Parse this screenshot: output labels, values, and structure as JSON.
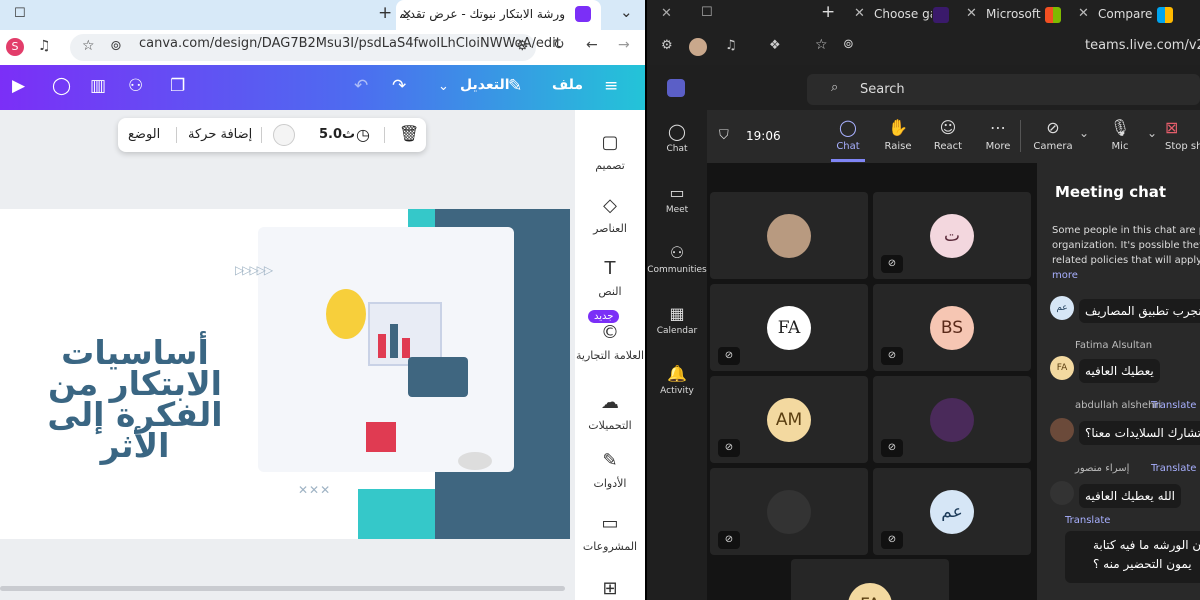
{
  "left_browser": {
    "tab_title": "ورشة الابتكار نيوتك - عرض تقديمي",
    "url": "canva.com/design/DAG7B2Msu3I/psdLaS4fwoILhCloiNWWoA/edit",
    "profile_initial": "S"
  },
  "canva_toolbar": {
    "file_label": "ملف",
    "edit_label": "التعديل"
  },
  "floating_toolbar": {
    "duration": "5.0ث",
    "add_animation": "إضافة حركة",
    "position": "الوضع"
  },
  "sidebar": {
    "items": [
      {
        "label": "تصميم",
        "icon": "design-icon"
      },
      {
        "label": "العناصر",
        "icon": "elements-icon"
      },
      {
        "label": "النص",
        "icon": "text-icon"
      },
      {
        "label": "العلامة التجارية",
        "icon": "brand-icon"
      },
      {
        "label": "التحميلات",
        "icon": "uploads-icon"
      },
      {
        "label": "الأدوات",
        "icon": "tools-icon"
      },
      {
        "label": "المشروعات",
        "icon": "projects-icon"
      }
    ],
    "new_badge": "جديد"
  },
  "slide": {
    "headline": "أساسيات الابتكار من الفكرة إلى الأثر"
  },
  "right_browser": {
    "tabs": [
      "Choose ga",
      "Microsoft",
      "Compare"
    ],
    "url": "teams.live.com/v2/",
    "search_placeholder": "Search"
  },
  "teams_rail": [
    "Chat",
    "Meet",
    "Communities",
    "Calendar",
    "Activity"
  ],
  "meeting": {
    "timer": "19:06",
    "buttons": [
      "Chat",
      "Raise",
      "React",
      "More",
      "Camera",
      "Mic",
      "Stop sh"
    ]
  },
  "participants": [
    {
      "initials": "",
      "type": "photo"
    },
    {
      "initials": "ت",
      "color": "#f3d7de",
      "text_color": "#5a2a3a"
    },
    {
      "initials": "FA",
      "color": "#ffffff",
      "text_color": "#222222"
    },
    {
      "initials": "BS",
      "color": "#f6c6b3",
      "text_color": "#5a2a1a"
    },
    {
      "initials": "AM",
      "color": "#f3d9a0",
      "text_color": "#5a3e10"
    },
    {
      "initials": "",
      "type": "photo"
    },
    {
      "initials": "",
      "type": "photo"
    },
    {
      "initials": "عم",
      "color": "#d6e6f6",
      "text_color": "#1e3c5a"
    },
    {
      "initials": "FA",
      "color": "#f3d9a0",
      "text_color": "#5a3e10"
    }
  ],
  "chat": {
    "title": "Meeting chat",
    "notice": "Some people in this chat are pa organization. It's possible they h related policies that will apply t",
    "more": "more",
    "messages": [
      {
        "author": "",
        "text": "نجرب تطبيق المصاريف",
        "avatar": "عم"
      },
      {
        "author": "Fatima Alsultan",
        "text": "يعطيك العافيه",
        "avatar": "FA"
      },
      {
        "author": "abdullah alshehri",
        "translate": "Translate",
        "text": "تشارك السلايدات معنا؟",
        "avatar": ""
      },
      {
        "author": "إسراء منصور",
        "translate": "Translate",
        "text": "الله يعطيك العافيه",
        "avatar": ""
      },
      {
        "author": "",
        "translate": "Translate",
        "text": "ن الورشه ما فيه كتابة",
        "text2": "يمون التحضير منه ؟",
        "avatar": ""
      }
    ]
  }
}
